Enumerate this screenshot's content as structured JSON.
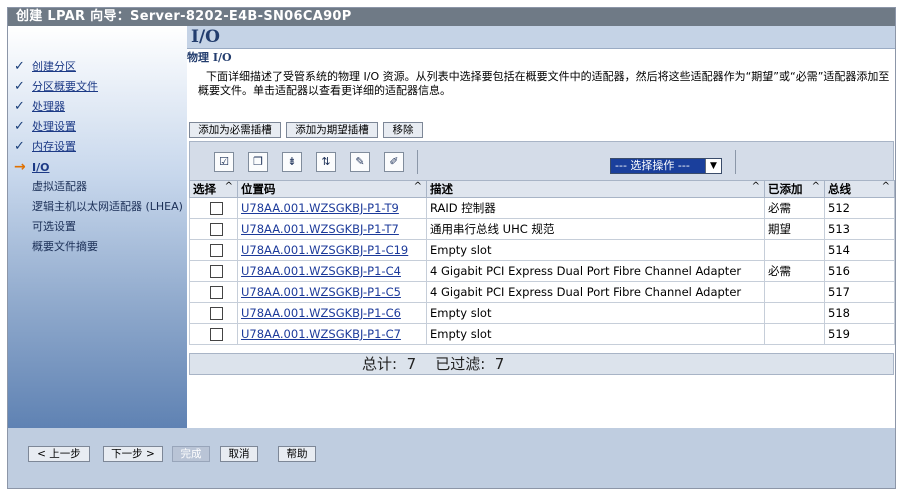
{
  "window": {
    "title": "创建 LPAR 向导：Server-8202-E4B-SN06CA90P"
  },
  "sidebar": {
    "steps": [
      {
        "label": "创建分区",
        "done": true
      },
      {
        "label": "分区概要文件",
        "done": true
      },
      {
        "label": "处理器",
        "done": true
      },
      {
        "label": "处理设置",
        "done": true
      },
      {
        "label": "内存设置",
        "done": true
      },
      {
        "label": "I/O",
        "current": true
      }
    ],
    "substeps": [
      "虚拟适配器",
      "逻辑主机以太网适配器 (LHEA)",
      "可选设置",
      "概要文件摘要"
    ]
  },
  "content": {
    "title": "I/O",
    "subtitle": "物理 I/O",
    "description": "下面详细描述了受管系统的物理 I/O 资源。从列表中选择要包括在概要文件中的适配器，然后将这些适配器作为“期望”或“必需”适配器添加至概要文件。单击适配器以查看更详细的适配器信息。"
  },
  "actions": {
    "add_required": "添加为必需插槽",
    "add_desired": "添加为期望插槽",
    "remove": "移除"
  },
  "toolbar": {
    "select_action": "--- 选择操作 ---"
  },
  "table": {
    "headers": {
      "select": "选择",
      "location": "位置码",
      "description": "描述",
      "added": "已添加",
      "bus": "总线"
    },
    "rows": [
      {
        "location": "U78AA.001.WZSGKBJ-P1-T9",
        "description": "RAID 控制器",
        "added": "必需",
        "bus": "512"
      },
      {
        "location": "U78AA.001.WZSGKBJ-P1-T7",
        "description": "通用串行总线 UHC 规范",
        "added": "期望",
        "bus": "513"
      },
      {
        "location": "U78AA.001.WZSGKBJ-P1-C19",
        "description": "Empty slot",
        "added": "",
        "bus": "514"
      },
      {
        "location": "U78AA.001.WZSGKBJ-P1-C4",
        "description": "4 Gigabit PCI Express Dual Port Fibre Channel Adapter",
        "added": "必需",
        "bus": "516"
      },
      {
        "location": "U78AA.001.WZSGKBJ-P1-C5",
        "description": "4 Gigabit PCI Express Dual Port Fibre Channel Adapter",
        "added": "",
        "bus": "517"
      },
      {
        "location": "U78AA.001.WZSGKBJ-P1-C6",
        "description": "Empty slot",
        "added": "",
        "bus": "518"
      },
      {
        "location": "U78AA.001.WZSGKBJ-P1-C7",
        "description": "Empty slot",
        "added": "",
        "bus": "519"
      }
    ],
    "footer": "总计:  7    已过滤:  7"
  },
  "nav_buttons": {
    "back": "< 上一步",
    "next": "下一步 >",
    "finish": "完成",
    "cancel": "取消",
    "help": "帮助"
  }
}
